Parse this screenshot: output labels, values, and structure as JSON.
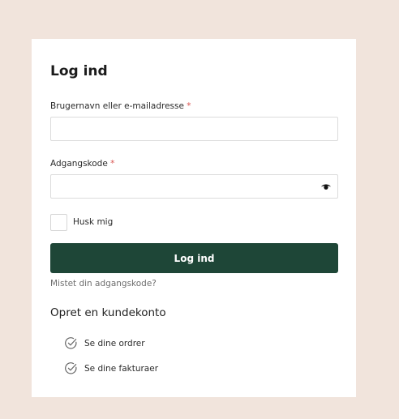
{
  "login": {
    "title": "Log ind",
    "username_label": "Brugernavn eller e-mailadresse",
    "password_label": "Adgangskode",
    "required_marker": "*",
    "username_value": "",
    "password_value": "",
    "remember_label": "Husk mig",
    "submit_label": "Log ind",
    "lost_password": "Mistet din adgangskode?"
  },
  "register": {
    "title": "Opret en kundekonto",
    "benefits": [
      "Se dine ordrer",
      "Se dine fakturaer"
    ]
  },
  "icons": {
    "password_toggle": "eye-icon",
    "benefit": "check-circle-icon"
  },
  "colors": {
    "background": "#f1e4dc",
    "button": "#1e4637",
    "required": "#d9534f"
  }
}
